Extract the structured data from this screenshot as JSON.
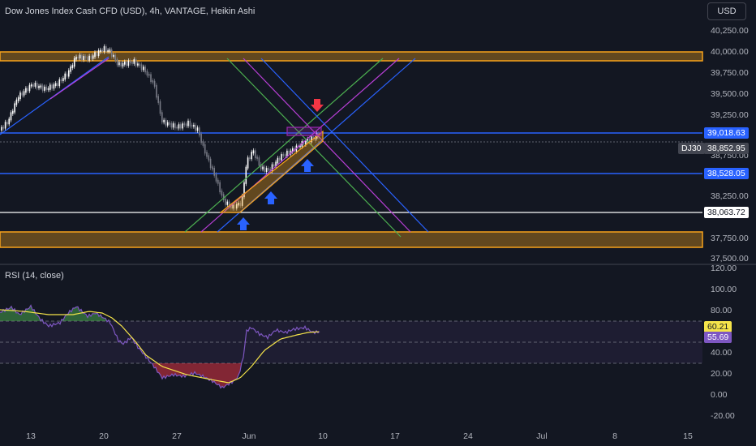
{
  "header": {
    "title": "Dow Jones Index Cash CFD (USD), 4h, VANTAGE, Heikin Ashi",
    "currency": "USD"
  },
  "price_axis": {
    "labels": [
      "40,250.00",
      "40,000.00",
      "39,750.00",
      "39,500.00",
      "39,250.00",
      "38,750.00",
      "38,250.00",
      "37,750.00",
      "37,500.00"
    ]
  },
  "price_tags": {
    "resistance": "39,018.63",
    "current": "38,852.95",
    "support": "38,528.05",
    "low": "38,063.72",
    "symbol": "DJ30"
  },
  "rsi": {
    "title": "RSI (14, close)",
    "axis_labels": [
      "120.00",
      "100.00",
      "80.00",
      "40.00",
      "20.00",
      "0.00",
      "-20.00"
    ],
    "ma_value": "60.21",
    "rsi_value": "55.69"
  },
  "time_axis": {
    "labels": [
      "13",
      "20",
      "27",
      "Jun",
      "10",
      "17",
      "24",
      "Jul",
      "8",
      "15"
    ]
  },
  "colors": {
    "background": "#131722",
    "up": "#ffffff",
    "down": "#787b86",
    "zone": "#f7a21b",
    "blue_line": "#2962ff",
    "green_line": "#4caf50",
    "magenta_line": "#b83fd6",
    "rsi_line": "#7e57c2",
    "rsi_ma": "#f5e44a"
  }
}
